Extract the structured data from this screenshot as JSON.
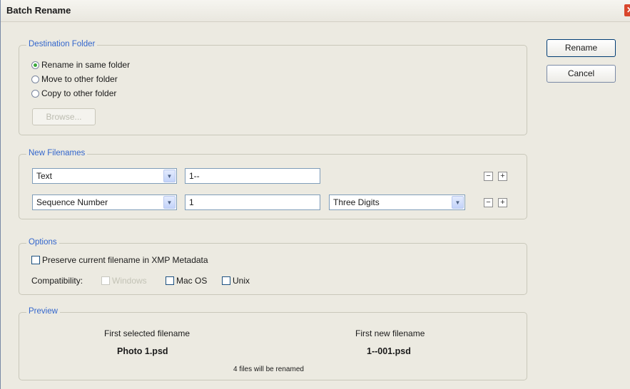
{
  "window": {
    "title": "Batch Rename",
    "close_glyph": "✕"
  },
  "buttons": {
    "rename": "Rename",
    "cancel": "Cancel"
  },
  "destination": {
    "legend": "Destination Folder",
    "options": [
      {
        "label": "Rename in same folder",
        "checked": true
      },
      {
        "label": "Move to other folder",
        "checked": false
      },
      {
        "label": "Copy to other folder",
        "checked": false
      }
    ],
    "browse": "Browse..."
  },
  "new_filenames": {
    "legend": "New Filenames",
    "rows": [
      {
        "type": "Text",
        "value": "1--",
        "format": ""
      },
      {
        "type": "Sequence Number",
        "value": "1",
        "format": "Three Digits"
      }
    ],
    "minus": "−",
    "plus": "+"
  },
  "options": {
    "legend": "Options",
    "preserve_label": "Preserve current filename in XMP Metadata",
    "preserve_checked": false,
    "compat_label": "Compatibility:",
    "windows": "Windows",
    "mac": "Mac OS",
    "unix": "Unix"
  },
  "preview": {
    "legend": "Preview",
    "first_selected_label": "First selected filename",
    "first_selected_value": "Photo 1.psd",
    "first_new_label": "First new filename",
    "first_new_value": "1--001.psd",
    "count_text": "4 files will be renamed"
  },
  "icons": {
    "dropdown": "chevron-down-icon",
    "close": "close-icon"
  }
}
